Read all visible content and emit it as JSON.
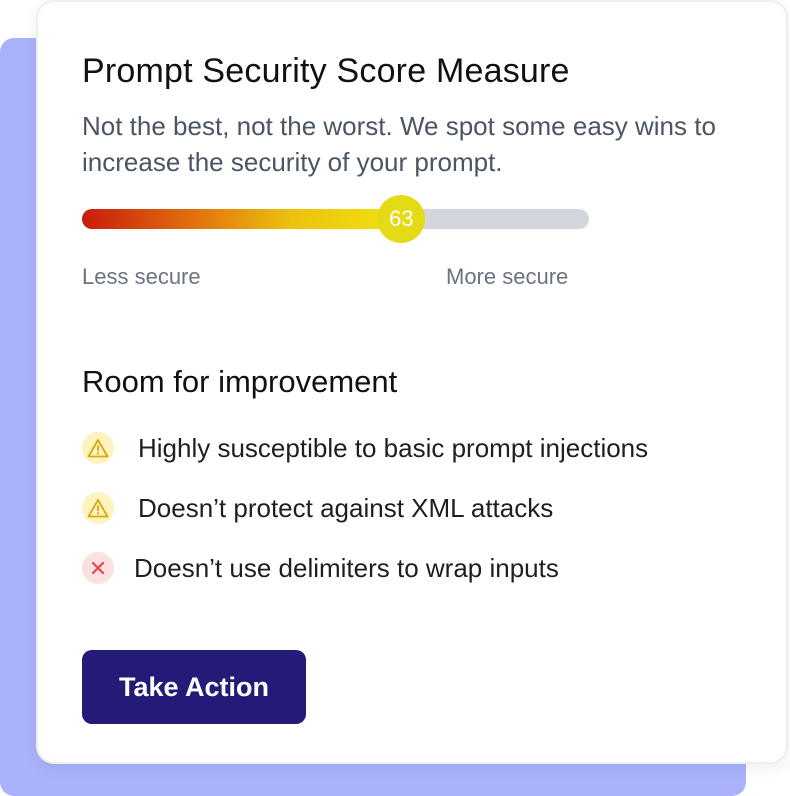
{
  "card": {
    "title": "Prompt Security Score Measure",
    "subtitle": "Not the best, not the worst. We spot some easy wins to increase the security of your prompt."
  },
  "score": {
    "value": 63,
    "label": "63",
    "fraction": 0.63,
    "min_label": "Less secure",
    "max_label": "More secure"
  },
  "improvements": {
    "title": "Room for improvement",
    "items": [
      {
        "severity": "warning",
        "icon": "warning-icon",
        "text": "Highly susceptible to basic prompt injections"
      },
      {
        "severity": "warning",
        "icon": "warning-icon",
        "text": "Doesn’t protect against XML attacks"
      },
      {
        "severity": "error",
        "icon": "error-x-icon",
        "text": "Doesn’t use delimiters to wrap inputs"
      }
    ]
  },
  "action": {
    "label": "Take Action"
  },
  "colors": {
    "accent_button": "#241b78",
    "backdrop": "#aab2fb",
    "knob": "#e4da16",
    "warning_bg": "#fdf3bf",
    "warning_fg": "#d9a70c",
    "error_bg": "#fde0e0",
    "error_fg": "#e5484d"
  }
}
